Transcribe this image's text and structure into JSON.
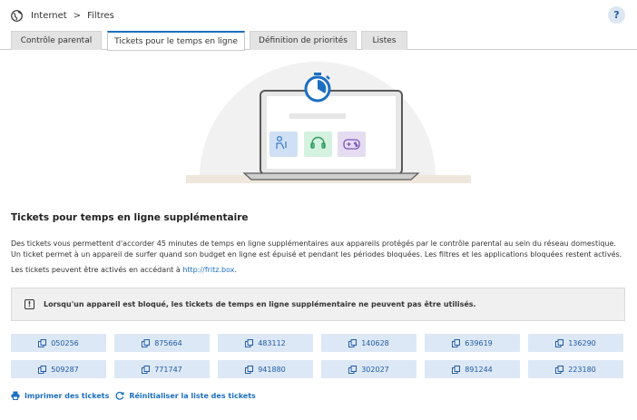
{
  "breadcrumb": {
    "section": "Internet",
    "page": "Filtres",
    "separator": ">"
  },
  "help": {
    "label": "?"
  },
  "tabs": [
    {
      "label": "Contrôle parental"
    },
    {
      "label": "Tickets pour le temps en ligne",
      "active": true
    },
    {
      "label": "Définition de priorités"
    },
    {
      "label": "Listes"
    }
  ],
  "content": {
    "heading": "Tickets pour temps en ligne supplémentaire",
    "description": "Des tickets vous permettent d'accorder 45 minutes de temps en ligne supplémentaires aux appareils protégés par le contrôle parental au sein du réseau domestique. Un ticket permet à un appareil de surfer quand son budget en ligne est épuisé et pendant les périodes bloquées. Les filtres et les applications bloquées restent activés.",
    "activation_text": "Les tickets peuvent être activés en accédant à",
    "activation_link": "http://fritz.box",
    "activation_suffix": ".",
    "notice": "Lorsqu'un appareil est bloqué, les tickets de temps en ligne supplémentaire ne peuvent pas être utilisés.",
    "notice_icon": "!"
  },
  "tickets": [
    "050256",
    "875664",
    "483112",
    "140628",
    "639619",
    "136290",
    "509287",
    "771747",
    "941880",
    "302027",
    "891244",
    "223180"
  ],
  "actions": {
    "print": "Imprimer des tickets",
    "reset": "Réinitialiser la liste des tickets"
  },
  "colors": {
    "accent": "#1c6fc1",
    "ticket_bg": "#dce8f6",
    "tab_bg": "#e3e3e3"
  },
  "icons": [
    "globe-icon",
    "copy-icon",
    "printer-icon",
    "refresh-icon",
    "stopwatch-icon"
  ]
}
